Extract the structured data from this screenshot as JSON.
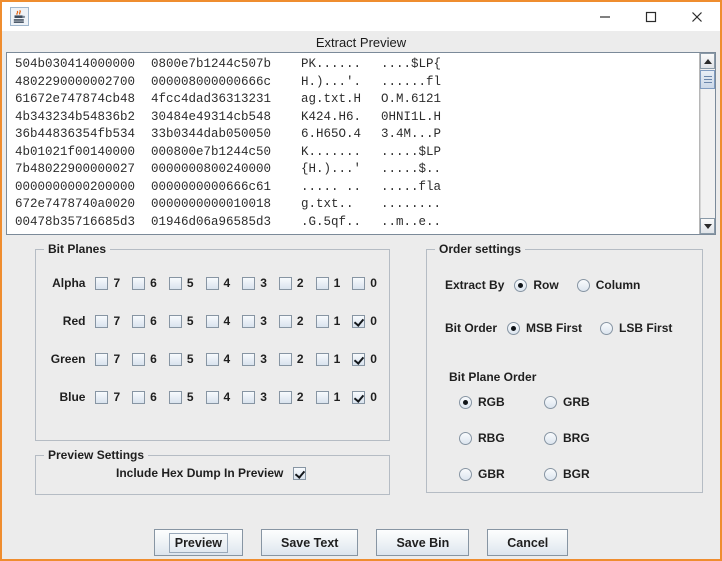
{
  "window": {
    "icon": "java-coffee-cup-icon",
    "controls": {
      "minimize": "minimize-icon",
      "maximize": "maximize-icon",
      "close": "close-icon"
    }
  },
  "dialog": {
    "title": "Extract Preview"
  },
  "preview": {
    "scrollbar": {
      "up": "scroll-up-arrow-icon",
      "down": "scroll-down-arrow-icon"
    },
    "lines": [
      {
        "hex1": "504b030414000000",
        "hex2": "0800e7b1244c507b",
        "asc1": "PK......",
        "asc2": "....$LP{"
      },
      {
        "hex1": "4802290000002700",
        "hex2": "000008000000666c",
        "asc1": "H.)...'.",
        "asc2": "......fl"
      },
      {
        "hex1": "61672e747874cb48",
        "hex2": "4fcc4dad36313231",
        "asc1": "ag.txt.H",
        "asc2": "O.M.6121"
      },
      {
        "hex1": "4b343234b54836b2",
        "hex2": "30484e49314cb548",
        "asc1": "K424.H6.",
        "asc2": "0HNI1L.H"
      },
      {
        "hex1": "36b44836354fb534",
        "hex2": "33b0344dab050050",
        "asc1": "6.H65O.4",
        "asc2": "3.4M...P"
      },
      {
        "hex1": "4b01021f00140000",
        "hex2": "000800e7b1244c50",
        "asc1": "K.......",
        "asc2": ".....$LP"
      },
      {
        "hex1": "7b48022900000027",
        "hex2": "0000000800240000",
        "asc1": "{H.)...'",
        "asc2": ".....$.."
      },
      {
        "hex1": "0000000000200000",
        "hex2": "0000000000666c61",
        "asc1": "..... ..",
        "asc2": ".....fla"
      },
      {
        "hex1": "672e7478740a0020",
        "hex2": "0000000000010018",
        "asc1": "g.txt..",
        "asc2": "........"
      },
      {
        "hex1": "00478b35716685d3",
        "hex2": "01946d06a96585d3",
        "asc1": ".G.5qf..",
        "asc2": "..m..e.."
      }
    ]
  },
  "bit_planes": {
    "title": "Bit Planes",
    "bits": [
      "7",
      "6",
      "5",
      "4",
      "3",
      "2",
      "1",
      "0"
    ],
    "rows": [
      {
        "label": "Alpha",
        "checked": [
          false,
          false,
          false,
          false,
          false,
          false,
          false,
          false
        ]
      },
      {
        "label": "Red",
        "checked": [
          false,
          false,
          false,
          false,
          false,
          false,
          false,
          true
        ]
      },
      {
        "label": "Green",
        "checked": [
          false,
          false,
          false,
          false,
          false,
          false,
          false,
          true
        ]
      },
      {
        "label": "Blue",
        "checked": [
          false,
          false,
          false,
          false,
          false,
          false,
          false,
          true
        ]
      }
    ]
  },
  "order_settings": {
    "title": "Order settings",
    "extract_by": {
      "label": "Extract By",
      "options": [
        {
          "label": "Row",
          "selected": true
        },
        {
          "label": "Column",
          "selected": false
        }
      ]
    },
    "bit_order": {
      "label": "Bit Order",
      "options": [
        {
          "label": "MSB First",
          "selected": true
        },
        {
          "label": "LSB First",
          "selected": false
        }
      ]
    },
    "bit_plane_order": {
      "label": "Bit Plane Order",
      "options": [
        {
          "label": "RGB",
          "selected": true
        },
        {
          "label": "GRB",
          "selected": false
        },
        {
          "label": "RBG",
          "selected": false
        },
        {
          "label": "BRG",
          "selected": false
        },
        {
          "label": "GBR",
          "selected": false
        },
        {
          "label": "BGR",
          "selected": false
        }
      ]
    }
  },
  "preview_settings": {
    "title": "Preview Settings",
    "include_hex_dump": {
      "label": "Include Hex Dump In Preview",
      "checked": true
    }
  },
  "buttons": [
    {
      "label": "Preview",
      "focused": true
    },
    {
      "label": "Save Text",
      "focused": false
    },
    {
      "label": "Save Bin",
      "focused": false
    },
    {
      "label": "Cancel",
      "focused": false
    }
  ],
  "colors": {
    "window_border": "#ef8d2f",
    "panel_bg": "#ececec",
    "text_bg": "#ffffff",
    "text_fg": "#2c2c2c",
    "control_border": "#8795a3"
  }
}
